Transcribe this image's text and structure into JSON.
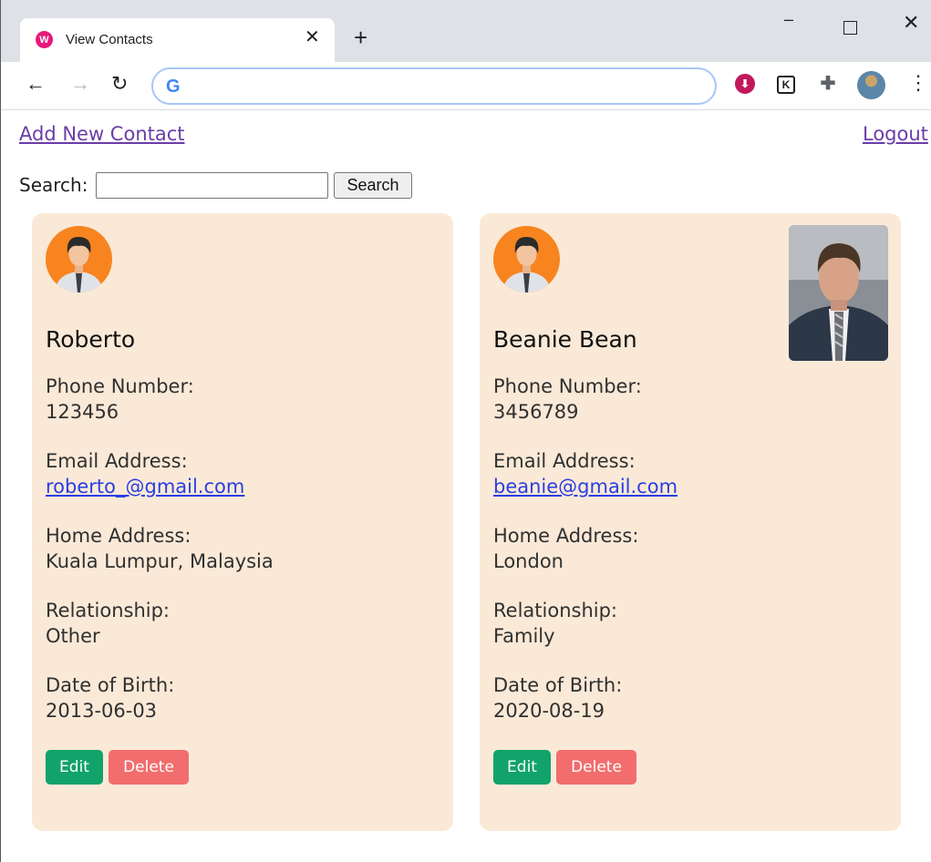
{
  "browser": {
    "tab_title": "View Contacts",
    "tab_favicon": "W",
    "tab_close": "✕",
    "new_tab": "+",
    "omnibox_logo": "G",
    "omnibox_value": "",
    "extension_k": "K"
  },
  "header": {
    "add_link": "Add New Contact",
    "logout_link": "Logout"
  },
  "search": {
    "label": "Search:",
    "value": "",
    "button": "Search"
  },
  "labels": {
    "phone": "Phone Number:",
    "email": "Email Address:",
    "home": "Home Address:",
    "relationship": "Relationship:",
    "dob": "Date of Birth:",
    "edit": "Edit",
    "delete": "Delete"
  },
  "contacts": [
    {
      "name": "Roberto",
      "phone": "123456",
      "email": "roberto_@gmail.com",
      "home": "Kuala Lumpur, Malaysia",
      "relationship": "Other",
      "dob": "2013-06-03"
    },
    {
      "name": "Beanie Bean",
      "phone": "3456789",
      "email": "beanie@gmail.com",
      "home": "London",
      "relationship": "Family",
      "dob": "2020-08-19"
    }
  ],
  "colors": {
    "card_bg": "#fae9d7",
    "edit_btn": "#12a36a",
    "delete_btn": "#f26d6d",
    "link_visited": "#6a3da8",
    "link_email": "#2a3fe0",
    "avatar_bg": "#f7841f"
  },
  "icons": [
    "tab-favicon-icon",
    "close-icon",
    "plus-icon",
    "minimize-icon",
    "maximize-icon",
    "back-arrow-icon",
    "forward-arrow-icon",
    "reload-icon",
    "google-icon",
    "download-extension-icon",
    "k-extension-icon",
    "puzzle-icon",
    "profile-avatar-icon",
    "more-vert-icon",
    "user-avatar-icon",
    "contact-photo"
  ]
}
